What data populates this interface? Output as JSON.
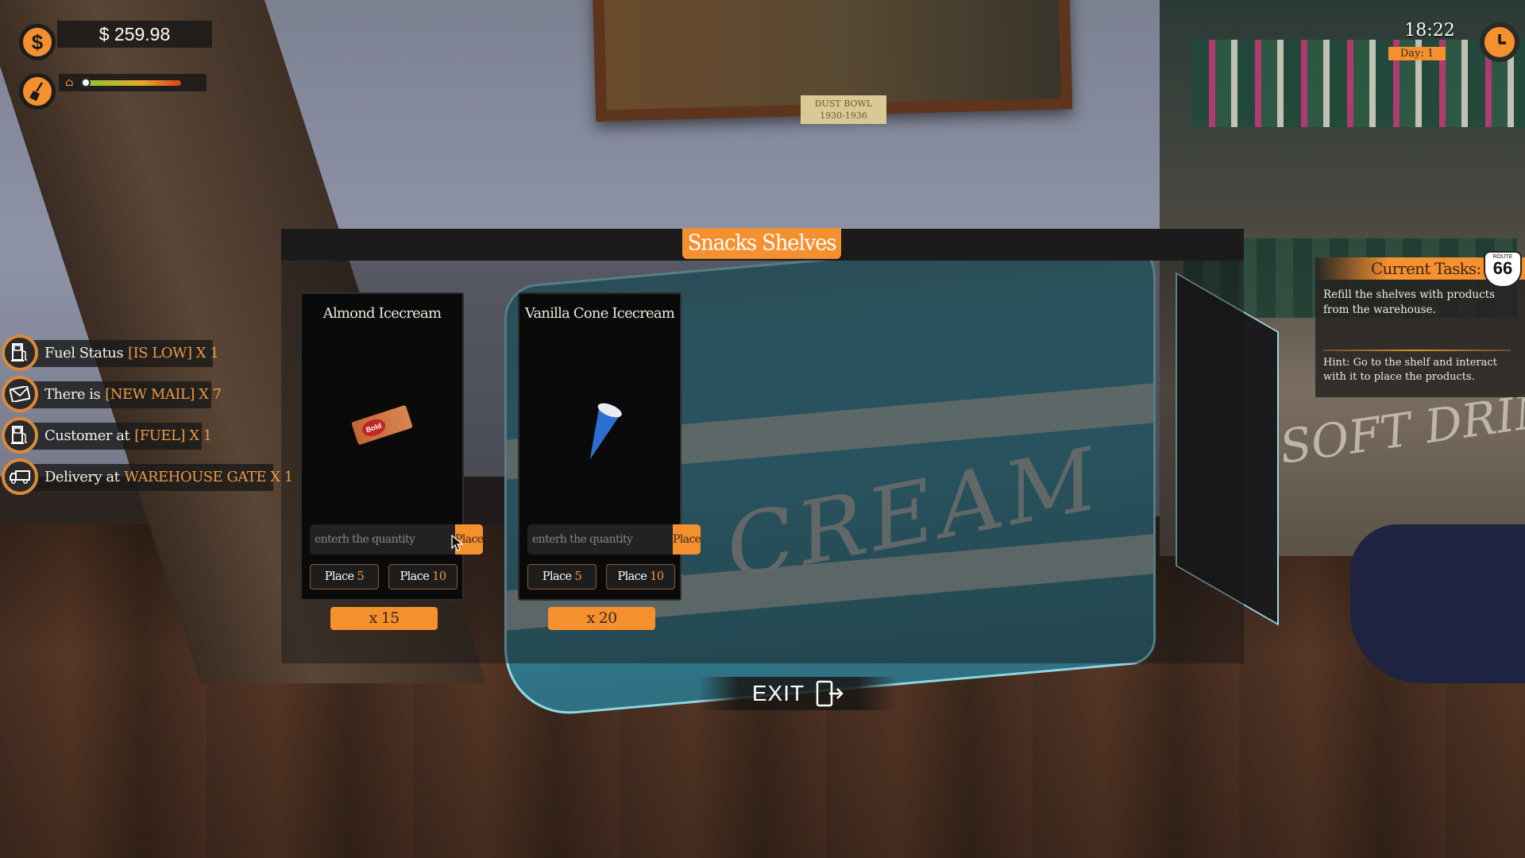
{
  "hud": {
    "money": "$ 259.98",
    "money_icon": "dollar-icon",
    "cleanliness_icon": "broom-icon",
    "cleanliness_level": 0.03,
    "time": "18:22",
    "day": "Day: 1",
    "clock_icon": "clock-icon"
  },
  "notifications": [
    {
      "icon": "fuel-pump-icon",
      "text": "Fuel Status",
      "highlight": "[IS LOW] X 1"
    },
    {
      "icon": "mail-icon",
      "text": "There is",
      "highlight": "[NEW MAIL] X 7"
    },
    {
      "icon": "fuel-pump-icon",
      "text": "Customer at",
      "highlight": "[FUEL] X 1"
    },
    {
      "icon": "truck-icon",
      "text": "Delivery at",
      "highlight": "WAREHOUSE GATE X 1"
    }
  ],
  "tasks": {
    "title": "Current Tasks:",
    "badge_top": "ROUTE",
    "badge_num": "66",
    "task": "Refill the shelves with products from the warehouse.",
    "hint": "Hint:  Go to the shelf and interact with it to place the products."
  },
  "panel": {
    "title": "Snacks Shelves",
    "products": [
      {
        "name": "Almond Icecream",
        "brand": "Bold",
        "placeholder": "enterh the quantity",
        "place_label": "Place",
        "quick": [
          {
            "label": "Place",
            "n": "5"
          },
          {
            "label": "Place",
            "n": "10"
          }
        ],
        "count": "x 15"
      },
      {
        "name": "Vanilla Cone Icecream",
        "placeholder": "enterh the quantity",
        "place_label": "Place",
        "quick": [
          {
            "label": "Place",
            "n": "5"
          },
          {
            "label": "Place",
            "n": "10"
          }
        ],
        "count": "x 20"
      }
    ]
  },
  "exit": {
    "label": "EXIT"
  },
  "scene": {
    "plaque": "DUST BOWL\n1930-1936",
    "freezer_text": "E CREAM",
    "shelf_text": "SOFT DRIN"
  },
  "colors": {
    "accent": "#f5902f",
    "panel_dark": "#1c1b1b",
    "highlight_text": "#ec9a44"
  }
}
